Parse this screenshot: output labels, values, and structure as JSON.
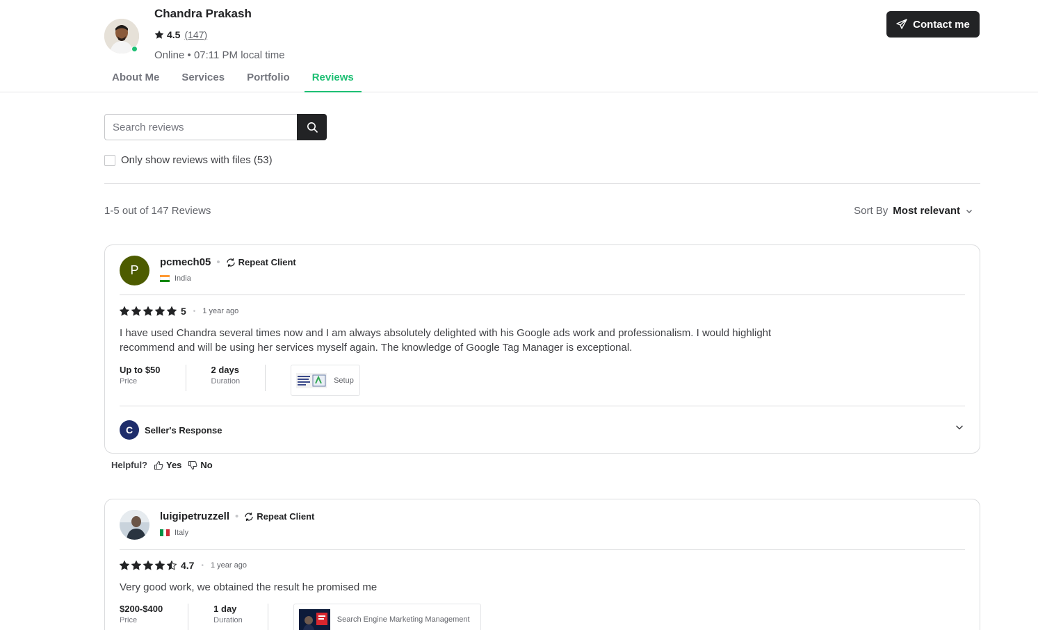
{
  "seller": {
    "name": "Chandra Prakash",
    "rating": "4.5",
    "review_count": "(147)",
    "status": "Online • 07:11 PM local time",
    "contact_label": "Contact me"
  },
  "tabs": [
    {
      "label": "About Me",
      "active": false
    },
    {
      "label": "Services",
      "active": false
    },
    {
      "label": "Portfolio",
      "active": false
    },
    {
      "label": "Reviews",
      "active": true
    }
  ],
  "search": {
    "placeholder": "Search reviews",
    "value": ""
  },
  "filter": {
    "files_label": "Only show reviews with files (53)",
    "checked": false
  },
  "results": {
    "count_text": "1-5 out of 147 Reviews",
    "sort_label": "Sort By",
    "sort_value": "Most relevant"
  },
  "reviews": [
    {
      "initial": "P",
      "username": "pcmech05",
      "badge": "Repeat Client",
      "country": "India",
      "rating": "5",
      "stars": 5,
      "time": "1 year ago",
      "text": "I have used Chandra several times now and I am always absolutely delighted with his Google ads work and professionalism. I would highlight recommend and will be using her services myself again. The knowledge of Google Tag Manager is exceptional.",
      "price_value": "Up to $50",
      "price_label": "Price",
      "duration_value": "2 days",
      "duration_label": "Duration",
      "gig": "Setup",
      "seller_response_label": "Seller's Response",
      "seller_initial": "C"
    },
    {
      "username": "luigipetruzzell",
      "badge": "Repeat Client",
      "country": "Italy",
      "rating": "4.7",
      "stars": 4.7,
      "time": "1 year ago",
      "text": "Very good work, we obtained the result he promised me",
      "price_value": "$200-$400",
      "price_label": "Price",
      "duration_value": "1 day",
      "duration_label": "Duration",
      "gig": "Search Engine Marketing Management"
    }
  ],
  "helpful": {
    "label": "Helpful?",
    "yes": "Yes",
    "no": "No"
  },
  "colors": {
    "accent_green": "#1dbf73",
    "dark": "#222325",
    "p_avatar": "#4d5c00",
    "c_avatar": "#1e2d6b"
  }
}
